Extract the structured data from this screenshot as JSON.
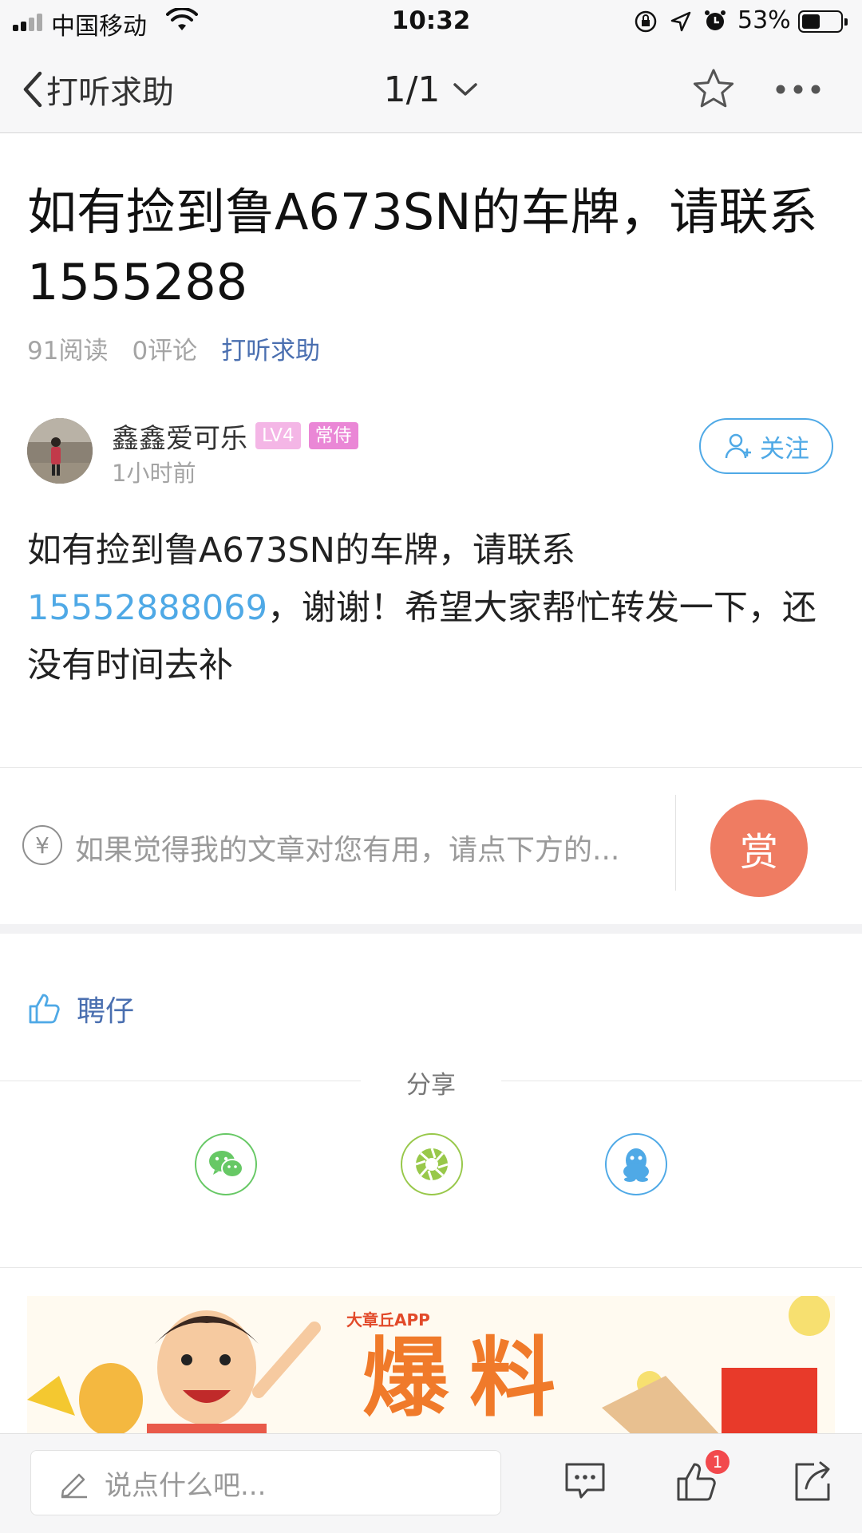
{
  "status_bar": {
    "carrier": "中国移动",
    "time": "10:32",
    "battery_percent": "53%",
    "battery_level": 0.53
  },
  "nav": {
    "back_label": "打听求助",
    "pager": "1/1"
  },
  "article": {
    "title": "如有捡到鲁A673SN的车牌，请联系1555288",
    "reads": "91阅读",
    "comments": "0评论",
    "category": "打听求助",
    "author": {
      "name": "鑫鑫爱可乐",
      "level_badge": "LV4",
      "rank_badge": "常侍",
      "time": "1小时前",
      "follow_label": "关注"
    },
    "body_prefix": "如有捡到鲁A673SN的车牌，请联系",
    "body_phone": "15552888069",
    "body_suffix": "，谢谢！希望大家帮忙转发一下，还没有时间去补"
  },
  "reward": {
    "currency_symbol": "¥",
    "tip": "如果觉得我的文章对您有用，请点下方的...",
    "button_label": "赏"
  },
  "likes": {
    "user": "聘仔"
  },
  "share": {
    "label": "分享",
    "targets": [
      "wechat",
      "moments",
      "qq"
    ]
  },
  "banner": {
    "app_text": "大章丘APP",
    "headline": "爆料"
  },
  "bottom_bar": {
    "comment_placeholder": "说点什么吧...",
    "like_count": "1"
  },
  "colors": {
    "accent_blue": "#4fa9e6",
    "link_blue": "#4a6fb0",
    "reward_orange": "#ef7c62",
    "badge_pink": "#ea87d6",
    "badge_red": "#f2494d"
  }
}
